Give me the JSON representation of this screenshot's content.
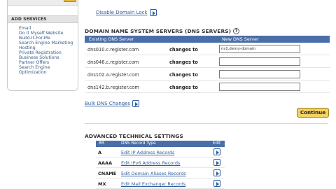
{
  "sidebar": {
    "add_services_heading": "ADD SERVICES",
    "items": [
      "Email",
      "Do It Myself Website",
      "Build-It-For-Me",
      "Search Engine Marketing",
      "Hosting",
      "Private Registration",
      "Business Solutions",
      "Partner Offers",
      "Search Engine",
      "Optimization"
    ]
  },
  "main": {
    "disable_lock_label": "Disable Domain Lock",
    "dns_section_title": "DOMAIN NAME SYSTEM SERVERS (DNS SERVERS)",
    "help_glyph": "?",
    "dns_table": {
      "col_existing": "Existing DNS Server",
      "col_new": "New DNS Server",
      "changes_label": "changes to",
      "rows": [
        {
          "existing": "dns010.c.register.com",
          "new_value": "ns1.demo-domain"
        },
        {
          "existing": "dns046.c.register.com",
          "new_value": ""
        },
        {
          "existing": "dns102.a.register.com",
          "new_value": ""
        },
        {
          "existing": "dns142.b.register.com",
          "new_value": ""
        }
      ]
    },
    "bulk_dns_label": "Bulk DNS Changes",
    "continue_label": "Continue",
    "advanced_title": "ADVANCED TECHNICAL SETTINGS",
    "advanced_table": {
      "col_rr": "RR",
      "col_type": "DNS Record Type",
      "col_edit": "Edit",
      "rows": [
        {
          "rr": "A",
          "label": "Edit IP Address Records"
        },
        {
          "rr": "AAAA",
          "label": "Edit IPv6 Address Records"
        },
        {
          "rr": "CNAME",
          "label": "Edit Domain Aliases Records"
        },
        {
          "rr": "MX",
          "label": "Edit Mail Exchanger Records"
        }
      ]
    }
  },
  "colors": {
    "header_blue": "#4a6ea8",
    "link_blue": "#2f5f9e",
    "continue_gold": "#f4d264"
  },
  "icons": {
    "arrow_button": "arrow-right-icon",
    "help": "help-icon"
  }
}
